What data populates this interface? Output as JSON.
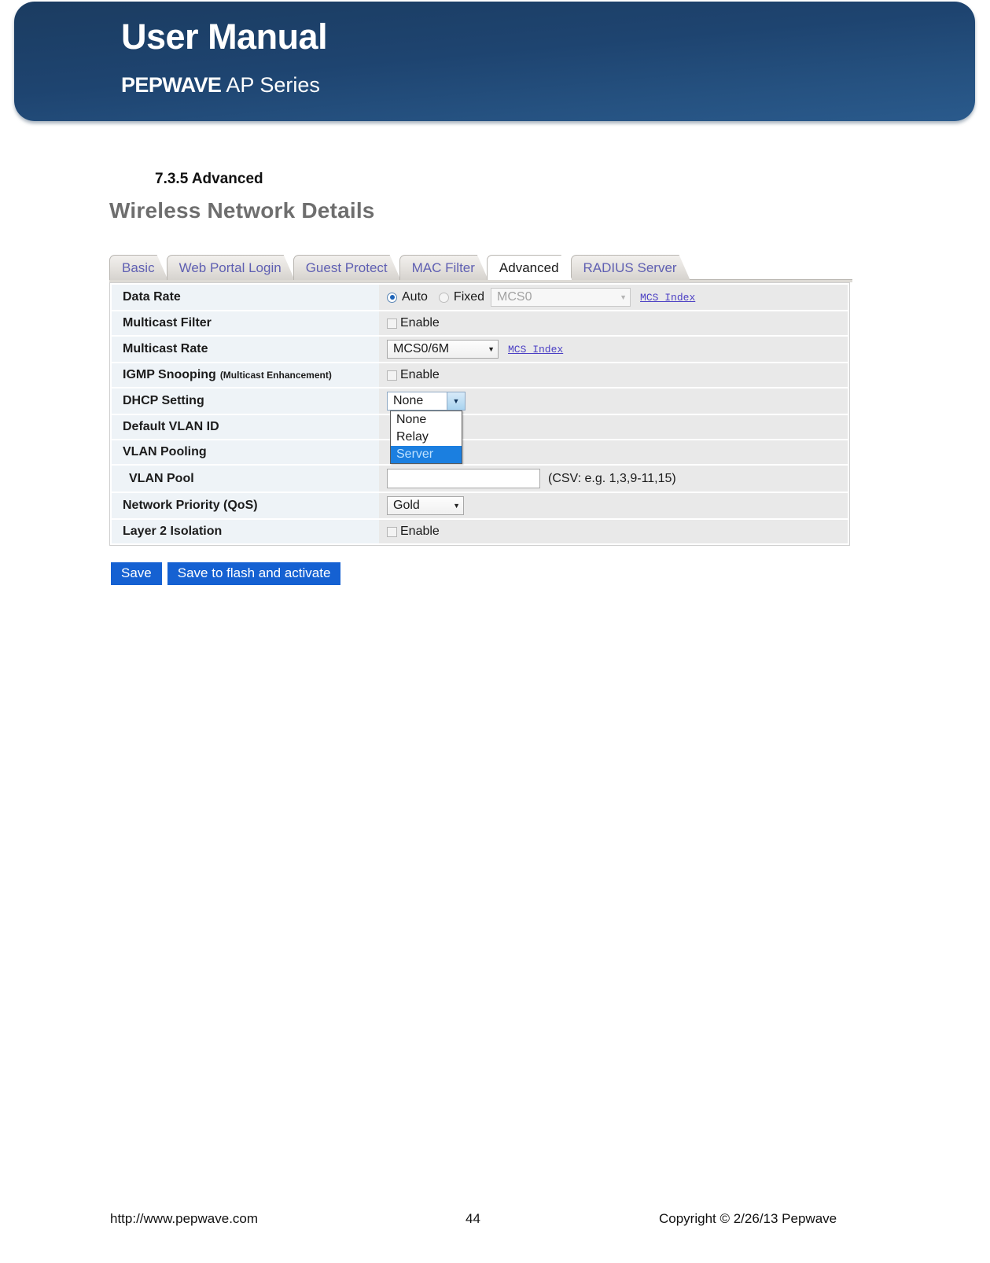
{
  "banner": {
    "title": "User Manual",
    "brand": "PEPWAVE",
    "series": " AP Series"
  },
  "section": {
    "heading": "7.3.5 Advanced"
  },
  "panel": {
    "title": "Wireless Network Details"
  },
  "tabs": [
    {
      "label": "Basic",
      "active": false
    },
    {
      "label": "Web Portal Login",
      "active": false
    },
    {
      "label": "Guest Protect",
      "active": false
    },
    {
      "label": "MAC Filter",
      "active": false
    },
    {
      "label": "Advanced",
      "active": true
    },
    {
      "label": "RADIUS Server",
      "active": false
    }
  ],
  "form": {
    "data_rate": {
      "label": "Data Rate",
      "auto_label": "Auto",
      "fixed_label": "Fixed",
      "fixed_value": "MCS0",
      "mcs_index_link": "MCS Index"
    },
    "multicast_filter": {
      "label": "Multicast Filter",
      "enable_label": "Enable"
    },
    "multicast_rate": {
      "label": "Multicast Rate",
      "value": "MCS0/6M",
      "mcs_index_link": "MCS Index"
    },
    "igmp_snooping": {
      "label": "IGMP Snooping",
      "sublabel": "(Multicast Enhancement)",
      "enable_label": "Enable"
    },
    "dhcp_setting": {
      "label": "DHCP Setting",
      "value": "None",
      "options": [
        "None",
        "Relay",
        "Server"
      ],
      "highlighted_option": "Server"
    },
    "default_vlan_id": {
      "label": "Default VLAN ID"
    },
    "vlan_pooling": {
      "label": "VLAN Pooling"
    },
    "vlan_pool": {
      "label": "VLAN Pool",
      "value": "",
      "hint": "(CSV: e.g. 1,3,9-11,15)"
    },
    "network_priority": {
      "label": "Network Priority (QoS)",
      "value": "Gold"
    },
    "layer2_isolation": {
      "label": "Layer 2 Isolation",
      "enable_label": "Enable"
    }
  },
  "buttons": {
    "save": "Save",
    "save_flash": "Save to flash and activate"
  },
  "footer": {
    "url": "http://www.pepwave.com",
    "page": "44",
    "copyright": "Copyright © 2/26/13 Pepwave"
  },
  "colors": {
    "banner_dark": "#1b3c61",
    "banner_light": "#2a5a8c",
    "tab_text": "#5f5fb2",
    "link": "#4b3fc4",
    "button_blue": "#1561d2",
    "select_highlight": "#1b7fe0",
    "label_bg": "#eef3f7",
    "value_bg": "#e9e9e9"
  }
}
